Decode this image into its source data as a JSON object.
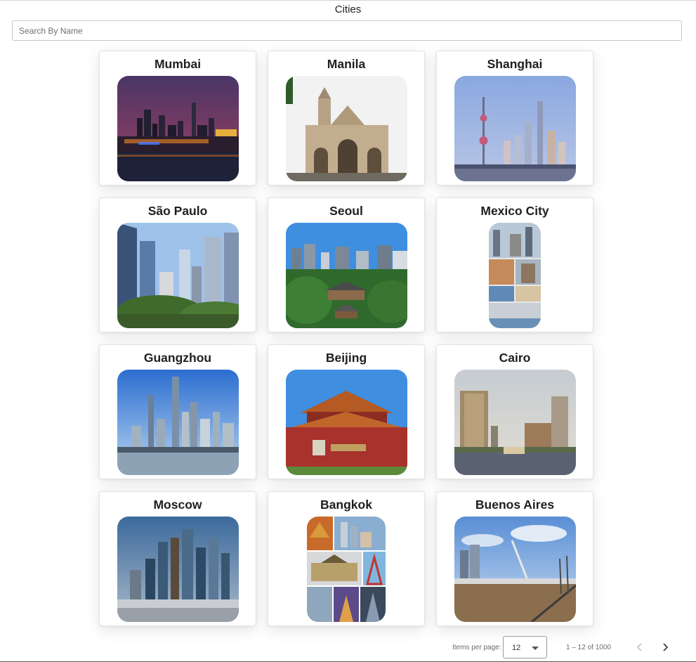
{
  "header": {
    "title": "Cities"
  },
  "search": {
    "placeholder": "Search By Name",
    "value": ""
  },
  "cities": [
    {
      "name": "Mumbai"
    },
    {
      "name": "Manila"
    },
    {
      "name": "Shanghai"
    },
    {
      "name": "São Paulo"
    },
    {
      "name": "Seoul"
    },
    {
      "name": "Mexico City"
    },
    {
      "name": "Guangzhou"
    },
    {
      "name": "Beijing"
    },
    {
      "name": "Cairo"
    },
    {
      "name": "Moscow"
    },
    {
      "name": "Bangkok"
    },
    {
      "name": "Buenos Aires"
    }
  ],
  "paginator": {
    "items_per_page_label": "Items per page:",
    "page_size": "12",
    "range_label": "1 – 12 of 1000",
    "prev_icon": "chevron-left-icon",
    "next_icon": "chevron-right-icon"
  },
  "colors": {
    "card_border": "#e4e4e4",
    "text": "#212121",
    "muted": "#6b6b6b",
    "disabled_icon": "#c4c4c4",
    "enabled_icon": "#424242"
  }
}
